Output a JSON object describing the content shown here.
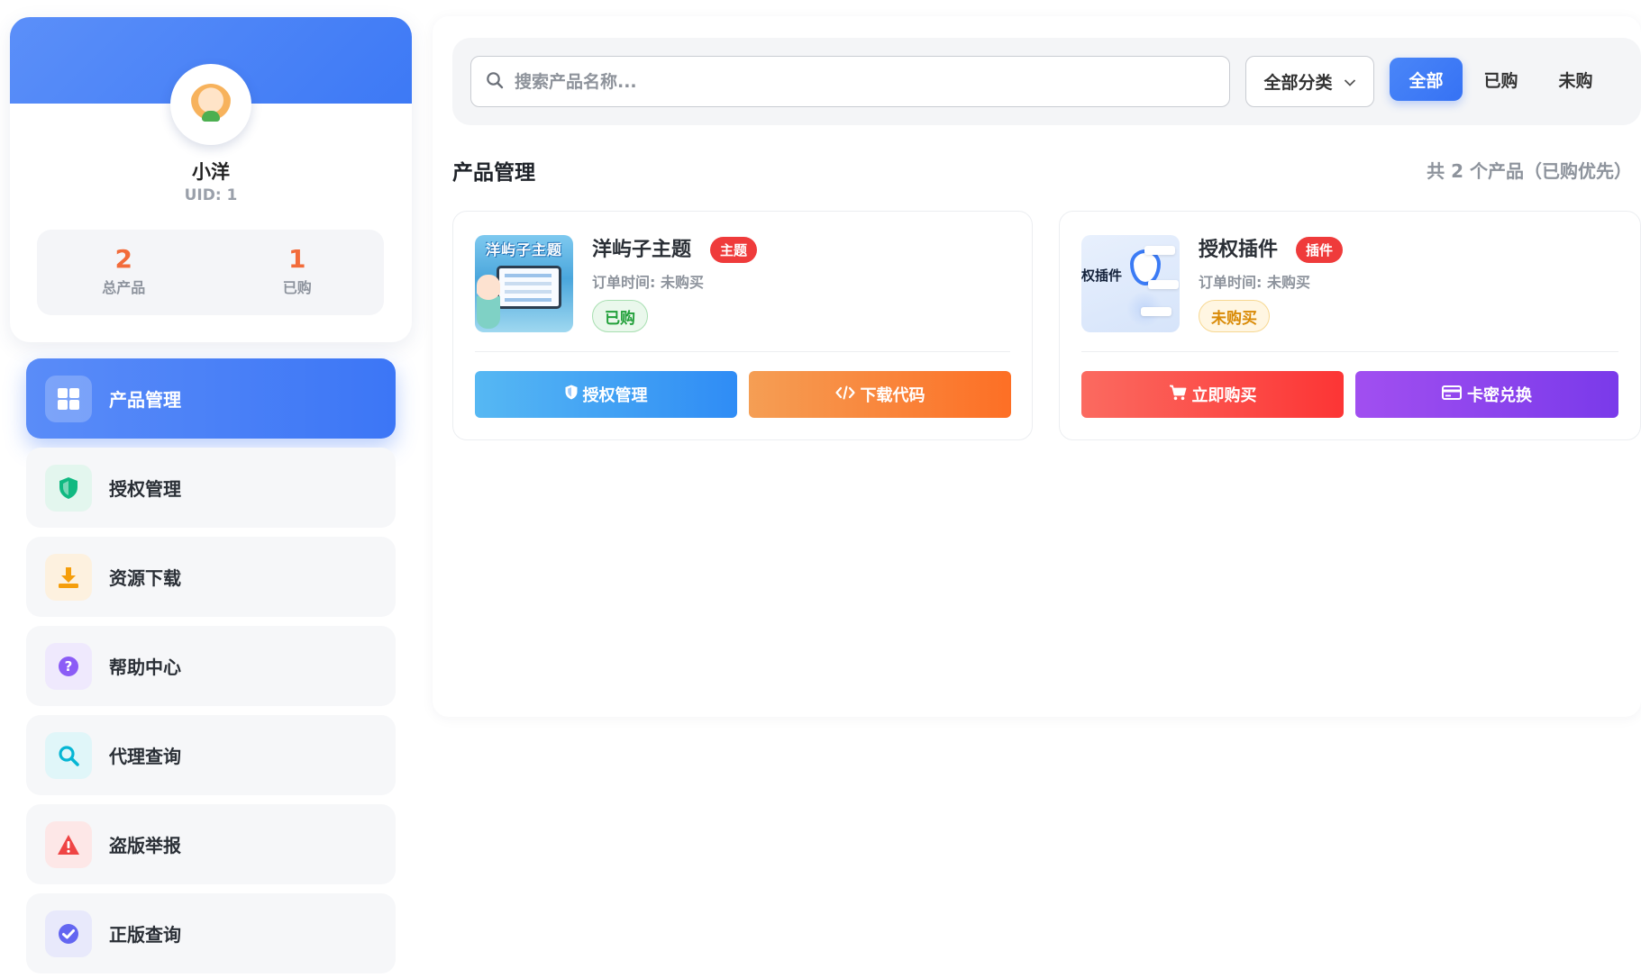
{
  "user": {
    "name": "小洋",
    "uid": "UID: 1",
    "stats": [
      {
        "value": "2",
        "label": "总产品"
      },
      {
        "value": "1",
        "label": "已购"
      }
    ]
  },
  "nav": [
    {
      "label": "产品管理",
      "icon": "grid-icon",
      "active": true
    },
    {
      "label": "授权管理",
      "icon": "shield-icon",
      "color": "#10b981"
    },
    {
      "label": "资源下载",
      "icon": "download-icon",
      "color": "#f59e0b"
    },
    {
      "label": "帮助中心",
      "icon": "question-icon",
      "color": "#8b5cf6"
    },
    {
      "label": "代理查询",
      "icon": "search-icon",
      "color": "#06b6d4"
    },
    {
      "label": "盗版举报",
      "icon": "warning-icon",
      "color": "#ef4444"
    },
    {
      "label": "正版查询",
      "icon": "check-circle-icon",
      "color": "#6366f1"
    }
  ],
  "toolbar": {
    "search_placeholder": "搜索产品名称...",
    "category_label": "全部分类",
    "filters": [
      "全部",
      "已购",
      "未购"
    ]
  },
  "section": {
    "title": "产品管理",
    "count": "共 2 个产品（已购优先）"
  },
  "products": [
    {
      "thumb_text": "洋屿子主题",
      "name": "洋屿子主题",
      "tag": "主题",
      "order": "订单时间: 未购买",
      "status": "已购",
      "buttons": [
        "授权管理",
        "下载代码"
      ]
    },
    {
      "thumb_text": "权插件",
      "name": "授权插件",
      "tag": "插件",
      "order": "订单时间: 未购买",
      "status": "未购买",
      "buttons": [
        "立即购买",
        "卡密兑换"
      ]
    }
  ],
  "colors": {
    "accent": "#3c76f6",
    "tag_red": "#ef3b3b",
    "status_green": "#22a03a",
    "status_amber": "#d98a06"
  }
}
